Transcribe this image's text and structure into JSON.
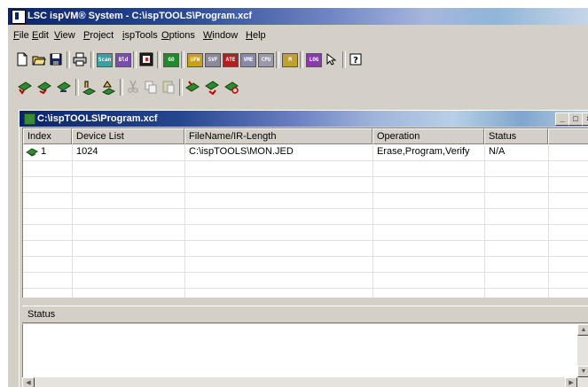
{
  "window": {
    "title": "LSC ispVM® System - C:\\ispTOOLS\\Program.xcf"
  },
  "menu": [
    {
      "label": "File"
    },
    {
      "label": "Edit"
    },
    {
      "label": "View"
    },
    {
      "label": "Project"
    },
    {
      "label": "ispTools"
    },
    {
      "label": "Options"
    },
    {
      "label": "Window"
    },
    {
      "label": "Help"
    }
  ],
  "toolbar_main": {
    "buttons": [
      {
        "icon": "new-file-icon"
      },
      {
        "icon": "open-folder-icon"
      },
      {
        "icon": "save-icon"
      },
      {
        "icon": "print-icon"
      },
      {
        "icon": "scan-chain-icon",
        "label": "Scan"
      },
      {
        "icon": "build-chain-icon",
        "label": "Bld"
      },
      {
        "icon": "program-icon"
      },
      {
        "icon": "go-icon",
        "label": "GO"
      },
      {
        "icon": "ufw-icon",
        "label": "UFW"
      },
      {
        "icon": "svf-icon",
        "label": "SVF"
      },
      {
        "icon": "ate-icon",
        "label": "ATE"
      },
      {
        "icon": "vme-icon",
        "label": "VME"
      },
      {
        "icon": "cpu-icon",
        "label": "CPU"
      },
      {
        "icon": "tool-icon",
        "label": "M"
      },
      {
        "icon": "log-icon",
        "label": "LOG"
      },
      {
        "icon": "pointer-icon"
      },
      {
        "icon": "help-icon"
      }
    ]
  },
  "toolbar_devices": {
    "buttons": [
      {
        "icon": "add-device-icon"
      },
      {
        "icon": "insert-device-icon"
      },
      {
        "icon": "remove-device-icon"
      },
      {
        "icon": "edit-device-icon"
      },
      {
        "icon": "device-info-icon"
      },
      {
        "icon": "cut-icon"
      },
      {
        "icon": "copy-icon"
      },
      {
        "icon": "paste-icon"
      },
      {
        "icon": "move-up-icon"
      },
      {
        "icon": "move-down-icon"
      },
      {
        "icon": "refresh-chain-icon"
      }
    ]
  },
  "project_window": {
    "title": "C:\\ispTOOLS\\Program.xcf",
    "buttons": [
      "_",
      "□",
      "×"
    ]
  },
  "table": {
    "columns": [
      "Index",
      "Device List",
      "FileName/IR-Length",
      "Operation",
      "Status"
    ],
    "rows": [
      {
        "index": "1",
        "device": "1024",
        "filename": "C:\\ispTOOLS\\MON.JED",
        "operation": "Erase,Program,Verify",
        "status": "N/A"
      }
    ]
  },
  "status_pane": {
    "label": "Status"
  },
  "colors": {
    "title_active": "#0a246a",
    "face": "#d4d0c8",
    "device_icon": "#3a8c34"
  }
}
